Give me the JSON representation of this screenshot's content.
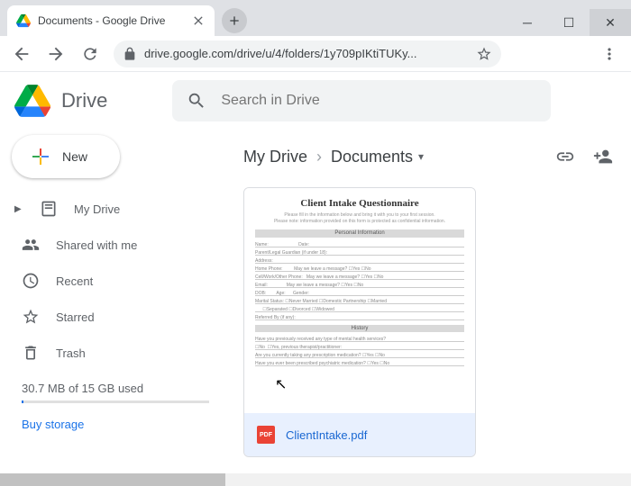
{
  "window": {
    "tab_title": "Documents - Google Drive",
    "url_display": "drive.google.com/drive/u/4/folders/1y709pIKtiTUKy..."
  },
  "brand": "Drive",
  "search": {
    "placeholder": "Search in Drive"
  },
  "new_button": "New",
  "sidebar": {
    "items": [
      {
        "label": "My Drive"
      },
      {
        "label": "Shared with me"
      },
      {
        "label": "Recent"
      },
      {
        "label": "Starred"
      },
      {
        "label": "Trash"
      }
    ],
    "storage_text": "30.7 MB of 15 GB used",
    "buy_text": "Buy storage"
  },
  "breadcrumb": {
    "root": "My Drive",
    "current": "Documents"
  },
  "file": {
    "name": "ClientIntake.pdf",
    "preview_title": "Client Intake Questionnaire"
  }
}
